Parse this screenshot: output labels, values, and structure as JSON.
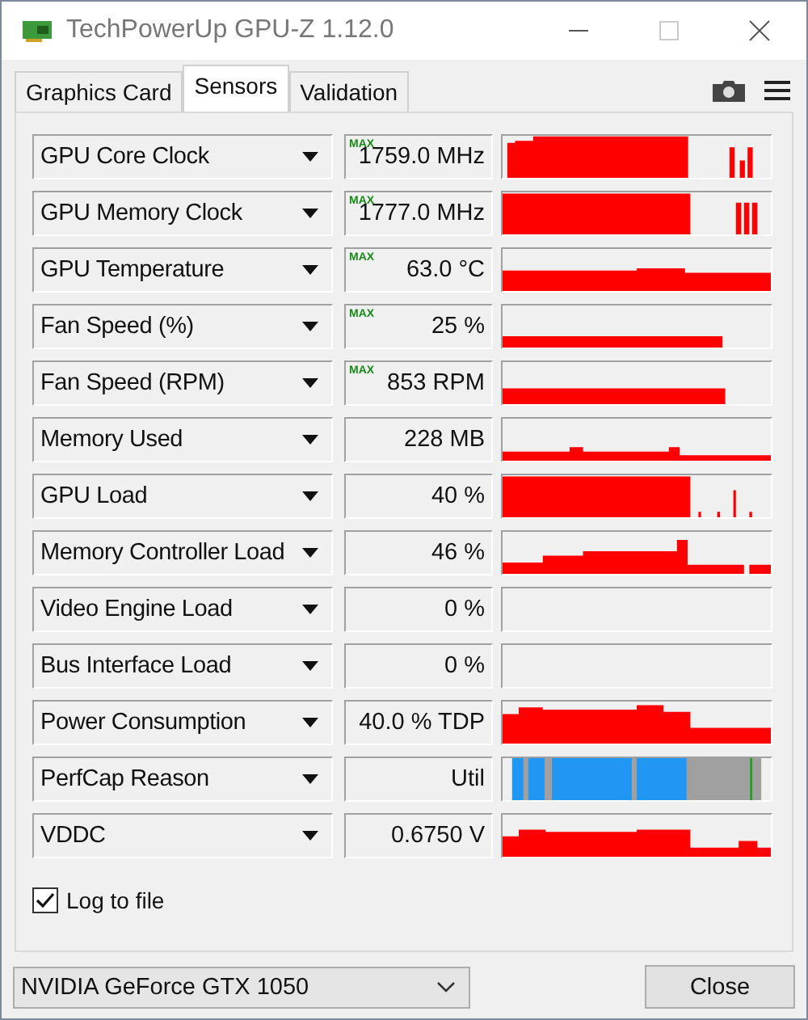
{
  "window": {
    "title": "TechPowerUp GPU-Z 1.12.0"
  },
  "tabs": [
    {
      "label": "Graphics Card",
      "selected": false
    },
    {
      "label": "Sensors",
      "selected": true
    },
    {
      "label": "Validation",
      "selected": false
    }
  ],
  "sensors": [
    {
      "name": "GPU Core Clock",
      "badge": "MAX",
      "reading": "1759.0 MHz",
      "kind": "line"
    },
    {
      "name": "GPU Memory Clock",
      "badge": "MAX",
      "reading": "1777.0 MHz",
      "kind": "line"
    },
    {
      "name": "GPU Temperature",
      "badge": "MAX",
      "reading": "63.0 °C",
      "kind": "line"
    },
    {
      "name": "Fan Speed (%)",
      "badge": "MAX",
      "reading": "25 %",
      "kind": "line"
    },
    {
      "name": "Fan Speed (RPM)",
      "badge": "MAX",
      "reading": "853 RPM",
      "kind": "line"
    },
    {
      "name": "Memory Used",
      "reading": "228 MB",
      "kind": "line"
    },
    {
      "name": "GPU Load",
      "reading": "40 %",
      "kind": "line"
    },
    {
      "name": "Memory Controller Load",
      "reading": "46 %",
      "kind": "line"
    },
    {
      "name": "Video Engine Load",
      "reading": "0 %",
      "kind": "empty"
    },
    {
      "name": "Bus Interface Load",
      "reading": "0 %",
      "kind": "empty"
    },
    {
      "name": "Power Consumption",
      "reading": "40.0 % TDP",
      "kind": "line"
    },
    {
      "name": "PerfCap Reason",
      "reading": "Util",
      "kind": "perfcap"
    },
    {
      "name": "VDDC",
      "reading": "0.6750 V",
      "kind": "line"
    }
  ],
  "log_to_file": {
    "label": "Log to file",
    "checked": true
  },
  "device": {
    "value": "NVIDIA GeForce GTX 1050"
  },
  "buttons": [
    {
      "label": "Close"
    }
  ]
}
